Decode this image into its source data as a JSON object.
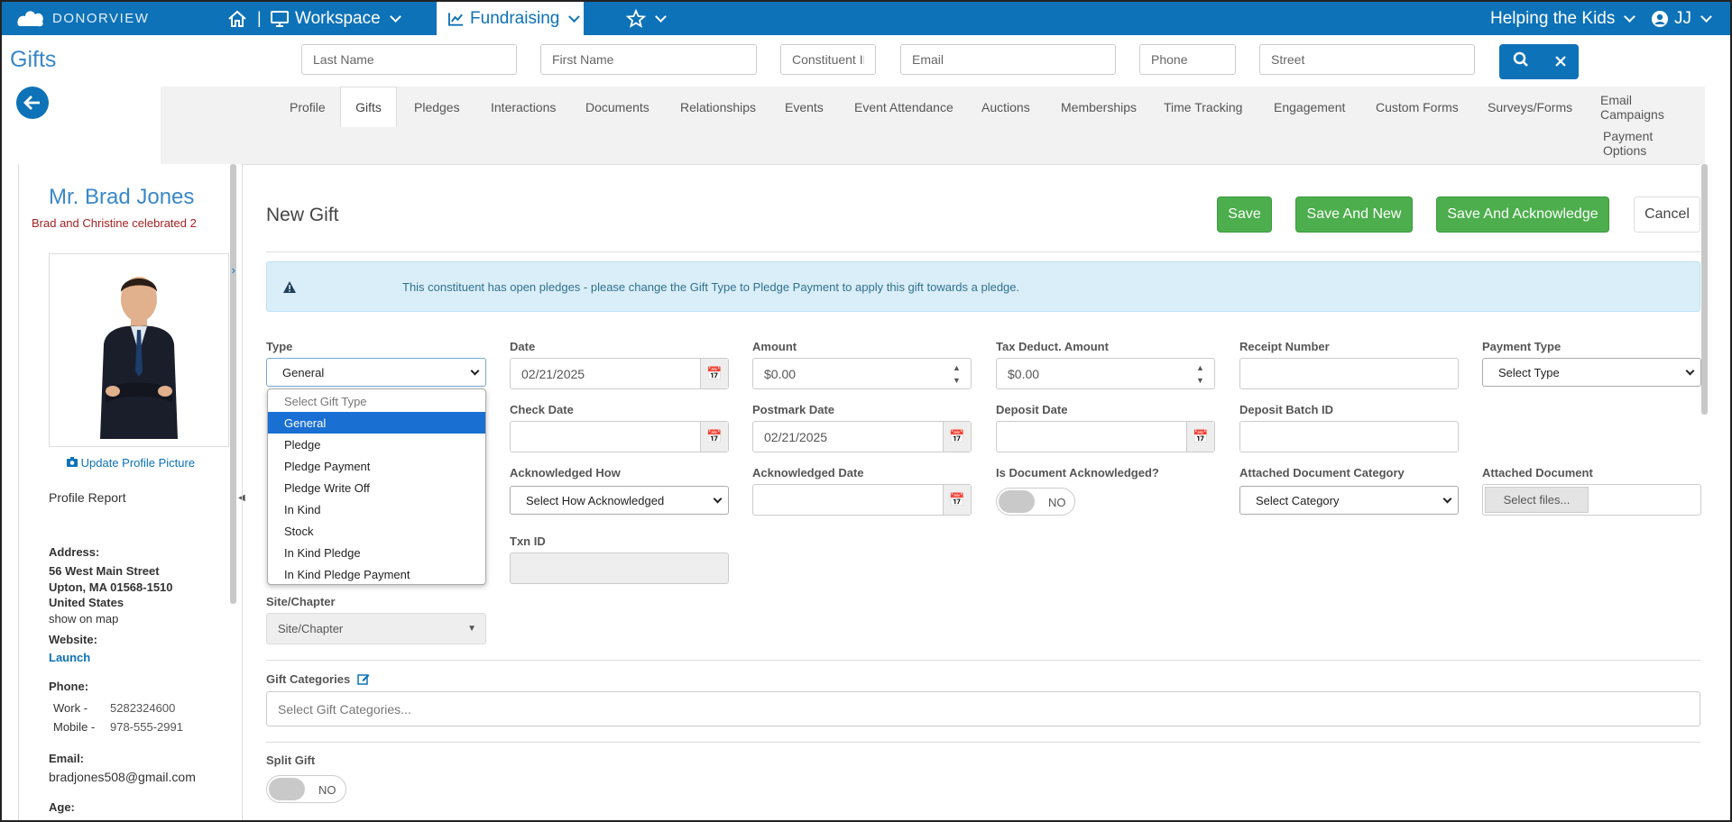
{
  "topbar": {
    "logo_text": "DONORVIEW",
    "workspace_label": "Workspace",
    "fundraising_label": "Fundraising",
    "org_label": "Helping the Kids",
    "user_label": "JJ",
    "separator": "|"
  },
  "search": {
    "last_name": "Last Name",
    "first_name": "First Name",
    "constituent_id": "Constituent ID",
    "email": "Email",
    "phone": "Phone",
    "street": "Street"
  },
  "page_title": "Gifts",
  "tabs": [
    "Profile",
    "Gifts",
    "Pledges",
    "Interactions",
    "Documents",
    "Relationships",
    "Events",
    "Event Attendance",
    "Auctions",
    "Memberships",
    "Time Tracking",
    "Engagement",
    "Custom Forms",
    "Surveys/Forms",
    "Email Campaigns",
    "Payment Options"
  ],
  "profile": {
    "name": "Mr. Brad Jones",
    "celebration": "Brad and Christine celebrated 2",
    "update_picture": "Update Profile Picture",
    "profile_report": "Profile Report",
    "address_label": "Address:",
    "address_line1": "56 West Main Street",
    "address_line2": "Upton, MA 01568-1510",
    "address_line3": "United States",
    "show_on_map": "show on map",
    "website_label": "Website:",
    "website_link": "Launch",
    "phone_label": "Phone:",
    "work_label": "Work -",
    "work_value": "5282324600",
    "mobile_label": "Mobile -",
    "mobile_value": "978-555-2991",
    "email_label": "Email:",
    "email_value": "bradjones508@gmail.com",
    "age_label": "Age:"
  },
  "form": {
    "title": "New Gift",
    "save": "Save",
    "save_new": "Save And New",
    "save_ack": "Save And Acknowledge",
    "cancel": "Cancel",
    "alert": "This constituent has open pledges - please change the Gift Type to Pledge Payment to apply this gift towards a pledge.",
    "type_label": "Type",
    "type_value": "General",
    "date_label": "Date",
    "date_value": "02/21/2025",
    "amount_label": "Amount",
    "amount_value": "$0.00",
    "tax_label": "Tax Deduct. Amount",
    "tax_value": "$0.00",
    "receipt_label": "Receipt Number",
    "payment_type_label": "Payment Type",
    "payment_type_value": "Select Type",
    "check_date_label": "Check Date",
    "postmark_label": "Postmark Date",
    "postmark_value": "02/21/2025",
    "deposit_date_label": "Deposit Date",
    "deposit_batch_label": "Deposit Batch ID",
    "ack_how_label": "Acknowledged How",
    "ack_how_value": "Select How Acknowledged",
    "ack_date_label": "Acknowledged Date",
    "doc_ack_label": "Is Document Acknowledged?",
    "toggle_no": "NO",
    "attach_cat_label": "Attached Document Category",
    "attach_cat_value": "Select Category",
    "attach_doc_label": "Attached Document",
    "select_files": "Select files...",
    "txn_label": "Txn ID",
    "site_label": "Site/Chapter",
    "site_value": "Site/Chapter",
    "gift_cat_label": "Gift Categories",
    "gift_cat_placeholder": "Select Gift Categories...",
    "split_label": "Split Gift"
  },
  "type_options": [
    "Select Gift Type",
    "General",
    "Pledge",
    "Pledge Payment",
    "Pledge Write Off",
    "In Kind",
    "Stock",
    "In Kind Pledge",
    "In Kind Pledge Payment"
  ]
}
